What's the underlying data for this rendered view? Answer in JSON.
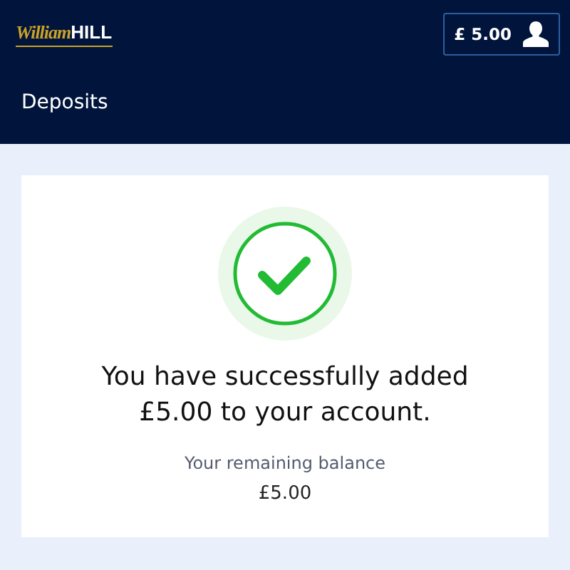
{
  "header": {
    "logo": {
      "script": "William",
      "block": "HILL"
    },
    "balance": "£ 5.00"
  },
  "page_title": "Deposits",
  "confirmation": {
    "message": "You have successfully added £5.00 to your account.",
    "balance_label": "Your remaining balance",
    "balance_value": "£5.00"
  }
}
